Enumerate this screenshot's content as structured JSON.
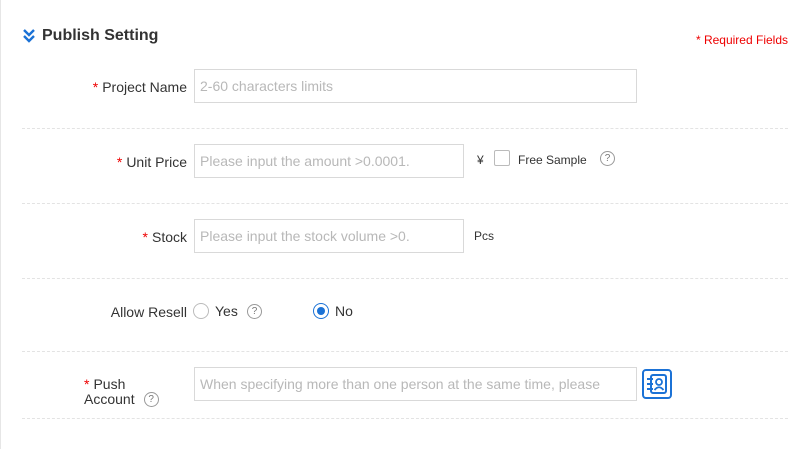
{
  "section": {
    "title": "Publish Setting",
    "required_note": "* Required Fields"
  },
  "project_name": {
    "required_mark": "*",
    "label": "Project Name",
    "placeholder": "2-60 characters limits",
    "value": ""
  },
  "unit_price": {
    "required_mark": "*",
    "label": "Unit Price",
    "placeholder": "Please input the amount >0.0001.",
    "value": "",
    "currency": "¥",
    "free_sample_label": "Free Sample",
    "free_sample_checked": false,
    "help": "?"
  },
  "stock": {
    "required_mark": "*",
    "label": "Stock",
    "placeholder": "Please input the stock volume >0.",
    "value": "",
    "unit": "Pcs"
  },
  "allow_resell": {
    "label": "Allow Resell",
    "options": [
      "Yes",
      "No"
    ],
    "selected": "No",
    "help": "?"
  },
  "push_account": {
    "required_mark": "*",
    "label_line1": "Push",
    "label_line2": "Account",
    "placeholder": "When specifying more than one person at the same time, please",
    "value": "",
    "help": "?"
  },
  "colors": {
    "accent": "#1b72d6",
    "required": "#e00000"
  },
  "icons": {
    "section_toggle": "double-chevron-down-icon",
    "contact_picker": "contact-book-icon"
  }
}
